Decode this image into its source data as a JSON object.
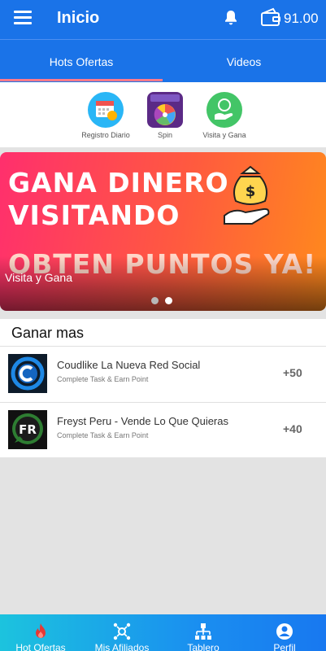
{
  "header": {
    "title": "Inicio",
    "wallet_balance": "91.00",
    "icons": [
      "menu-icon",
      "bell-icon",
      "wallet-icon"
    ]
  },
  "tabs": [
    {
      "label": "Hots Ofertas",
      "active": true
    },
    {
      "label": "Videos",
      "active": false
    }
  ],
  "shortcuts": [
    {
      "label": "Registro Diario",
      "icon": "calendar-icon"
    },
    {
      "label": "Spin",
      "icon": "spin-wheel-icon"
    },
    {
      "label": "Visita y Gana",
      "icon": "hand-money-icon"
    }
  ],
  "banner": {
    "lines": [
      "GANA DINERO",
      "VISITANDO",
      "OBTEN PUNTOS YA!"
    ],
    "caption": "Visita y Gana",
    "slides": 2,
    "active_slide": 2
  },
  "earn_more": {
    "title": "Ganar mas",
    "offers": [
      {
        "title": "Coudlike La Nueva Red Social",
        "subtitle": "Complete Task & Earn Point",
        "points": "+50",
        "logo": "coudlike-logo"
      },
      {
        "title": "Freyst Peru - Vende Lo Que Quieras",
        "subtitle": "Complete Task & Earn Point",
        "points": "+40",
        "logo": "freyst-logo"
      }
    ]
  },
  "bottom_nav": [
    {
      "label": "Hot Ofertas",
      "icon": "fire-icon"
    },
    {
      "label": "Mis Afiliados",
      "icon": "network-icon"
    },
    {
      "label": "Tablero",
      "icon": "trophy-icon"
    },
    {
      "label": "Perfil",
      "icon": "user-icon"
    }
  ],
  "colors": {
    "primary": "#1a73e8",
    "tab_indicator": "#ff7a8a",
    "banner_start": "#ff2f6d",
    "banner_end": "#ff8a1c"
  }
}
